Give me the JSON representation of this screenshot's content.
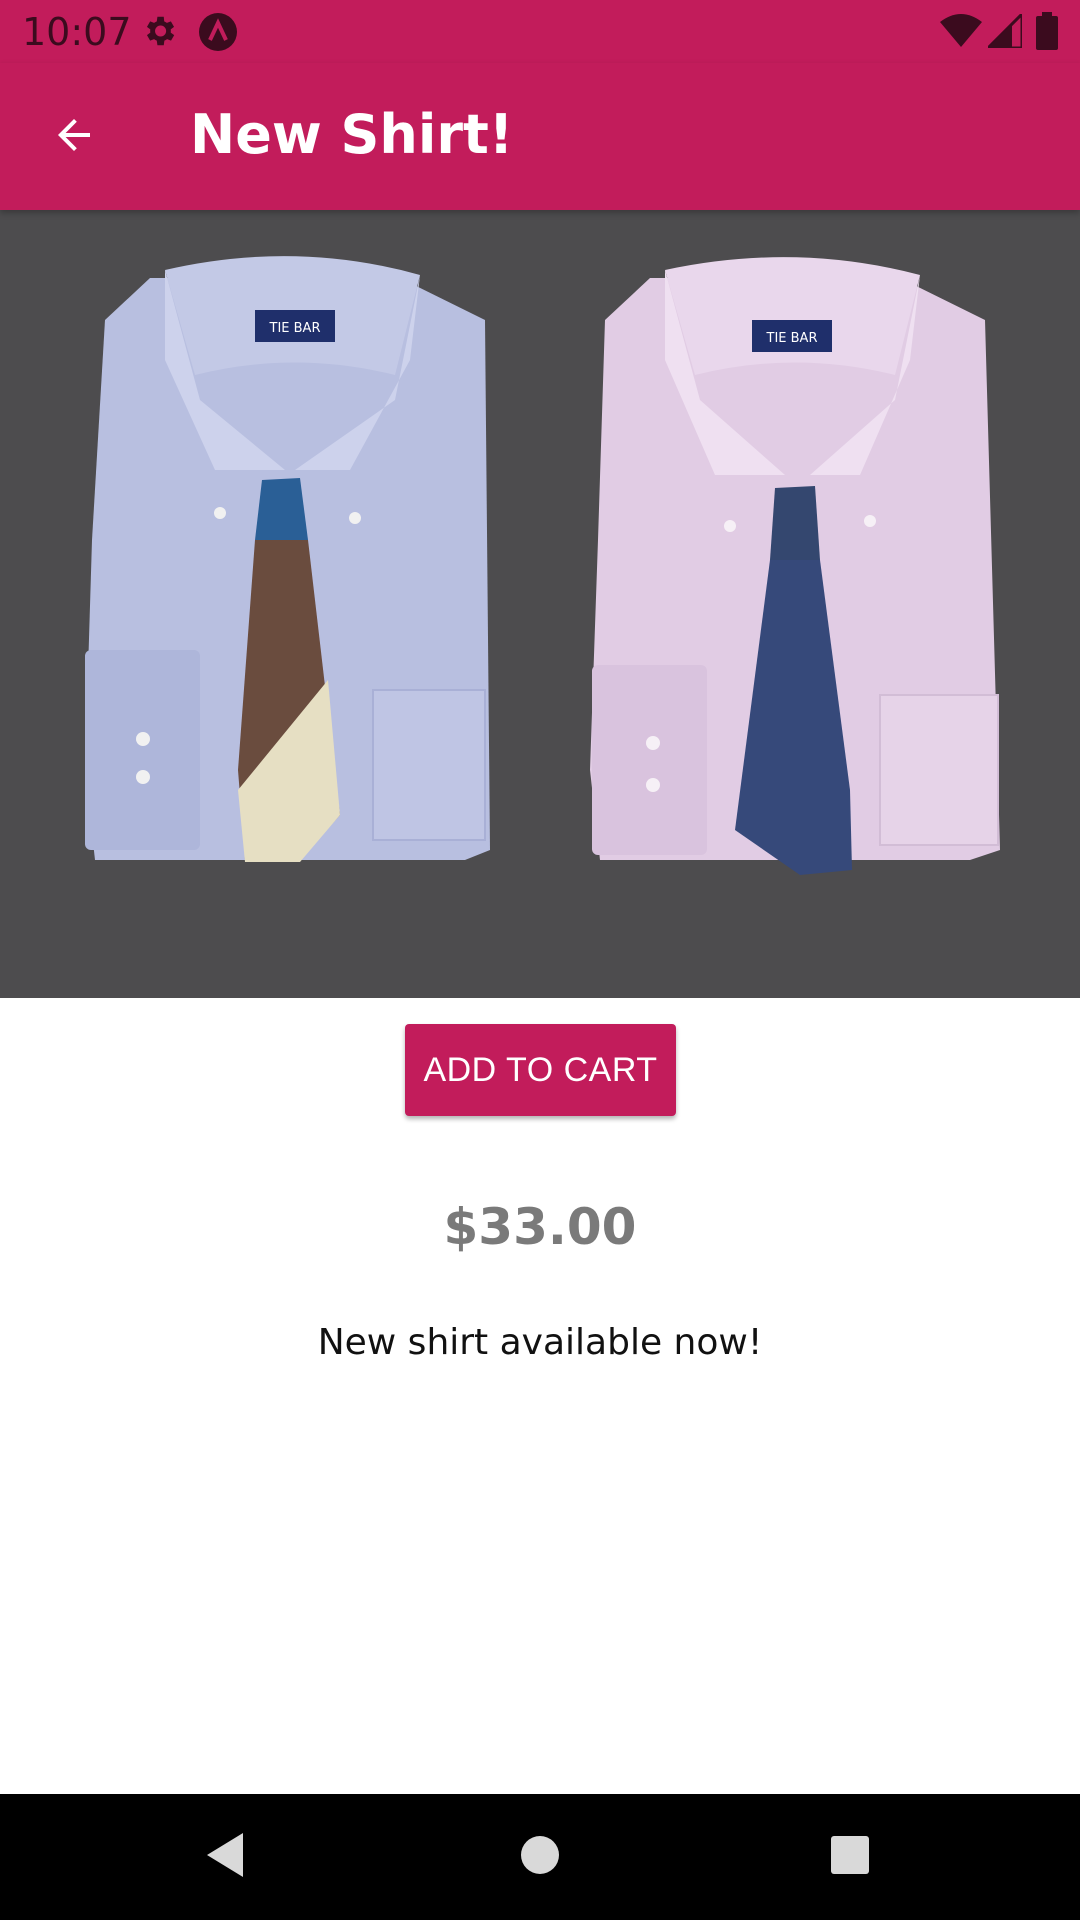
{
  "status_bar": {
    "time": "10:07",
    "icons": [
      "settings-icon",
      "app-notification-icon",
      "wifi-icon",
      "signal-icon",
      "battery-icon"
    ]
  },
  "app_bar": {
    "title": "New Shirt!",
    "back_icon": "arrow-back-icon"
  },
  "product": {
    "image_alt": "Two dress shirts with ties",
    "add_to_cart_label": "ADD TO CART",
    "price": "$33.00",
    "description": "New shirt available now!"
  },
  "nav_bar": {
    "icons": [
      "back-triangle-icon",
      "home-circle-icon",
      "recents-square-icon"
    ]
  },
  "colors": {
    "primary": "#c21c5b",
    "hero_background": "#4d4c4e",
    "price_text": "#7a7a7a"
  }
}
